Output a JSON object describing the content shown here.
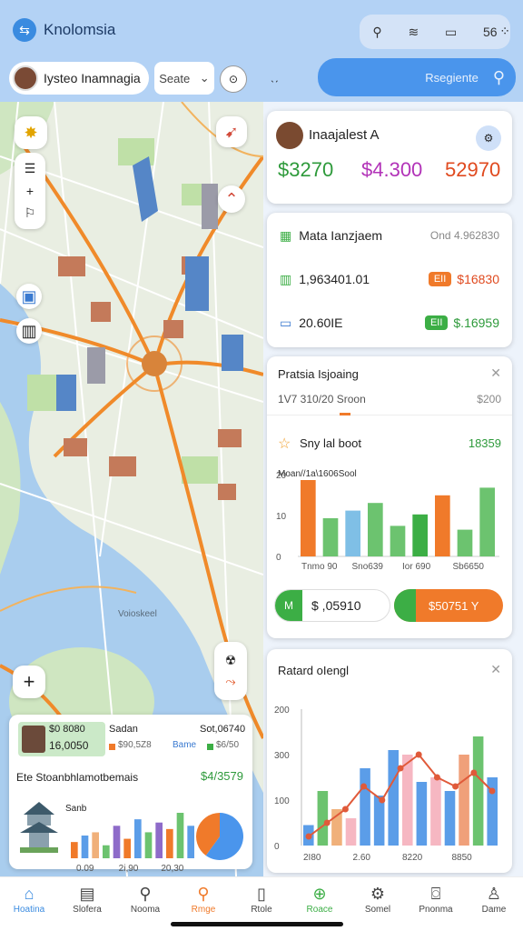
{
  "app": {
    "title": "Knolomsia"
  },
  "header": {
    "status_text": "56",
    "profile_name": "Iysteo Inamnagia",
    "select_value": "Seate",
    "search_label": "Rsegiente"
  },
  "map": {
    "area_label": "Voioskeel",
    "add_label": "+"
  },
  "card1": {
    "title": "Inaajalest A",
    "kpis": [
      {
        "value": "$3270",
        "color": "#2e9a3b"
      },
      {
        "value": "$4.300",
        "color": "#b233b8"
      },
      {
        "value": "52970",
        "color": "#e04a1f"
      }
    ]
  },
  "card2": {
    "rows": [
      {
        "icon": "building-icon",
        "label": "Mata Ianzjaem",
        "right": "Ond 4.962830",
        "badge": "",
        "badge_color": ""
      },
      {
        "icon": "chart-icon",
        "label": "1,963401.01",
        "right": "$16830",
        "badge": "EII",
        "badge_color": "#f07a2a"
      },
      {
        "icon": "card-icon",
        "label": "20.60IE",
        "right": "$.16959",
        "badge": "EII",
        "badge_color": "#3cae45"
      }
    ]
  },
  "card3": {
    "title": "Pratsia Isjoaing",
    "sub_left": "1V7  310/20  Sroon",
    "sub_right": "$200",
    "star_label": "Sny lal boot",
    "star_value": "18359",
    "chart_title": "Moan//1a\\1606Sool",
    "btn_left": "$ ,05910",
    "btn_right": "$50751 Y"
  },
  "card4": {
    "title": "Ratard oIengl"
  },
  "mini": {
    "tag": "$0 8080",
    "tag2": "16,0050",
    "label1": "Sadan",
    "label2": "Sot,06740",
    "legend1": "$90,5Z8",
    "legend2": "Bame",
    "legend3": "$6/50",
    "title": "Ete Stoanbhlamotbemais",
    "title_value": "$4/3579",
    "chart_caption": "Sanb"
  },
  "chart_data": [
    {
      "type": "bar",
      "title": "Moan//1a\\1606Sool",
      "categories": [
        "Tnmo 90",
        "Sno639",
        "Ior 690",
        "Sb6650"
      ],
      "series": [
        {
          "values": [
            20,
            10,
            12,
            14,
            8,
            11,
            16,
            7,
            18
          ],
          "colors": [
            "#f07a2a",
            "#6cc36f",
            "#7fbfe6",
            "#6cc36f",
            "#6cc36f",
            "#3cae45",
            "#f07a2a",
            "#6cc36f",
            "#6cc36f"
          ]
        }
      ],
      "yticks": [
        "20",
        "10",
        "0"
      ],
      "ylim": [
        0,
        30
      ]
    },
    {
      "type": "bar",
      "title": "Ratard oIengl",
      "categories": [
        "2I80",
        "2.60",
        "8220",
        "8850"
      ],
      "yticks": [
        "200",
        "300",
        "100",
        "0"
      ],
      "ylim": [
        0,
        300
      ],
      "bars": [
        {
          "value": 45,
          "color": "#5b9de8"
        },
        {
          "value": 120,
          "color": "#6cc36f"
        },
        {
          "value": 80,
          "color": "#f0b07a"
        },
        {
          "value": 60,
          "color": "#f6b7c2"
        },
        {
          "value": 170,
          "color": "#5b9de8"
        },
        {
          "value": 110,
          "color": "#5b9de8"
        },
        {
          "value": 210,
          "color": "#5b9de8"
        },
        {
          "value": 200,
          "color": "#f6b7c2"
        },
        {
          "value": 140,
          "color": "#5b9de8"
        },
        {
          "value": 150,
          "color": "#f6b7c2"
        },
        {
          "value": 120,
          "color": "#5b9de8"
        },
        {
          "value": 200,
          "color": "#f0a07a"
        },
        {
          "value": 240,
          "color": "#6cc36f"
        },
        {
          "value": 150,
          "color": "#5b9de8"
        }
      ],
      "line": [
        20,
        50,
        80,
        130,
        100,
        170,
        200,
        150,
        130,
        160,
        120
      ]
    },
    {
      "type": "bar",
      "title": "Sanb",
      "categories": [
        "0.09",
        "2i,90",
        "20,30"
      ],
      "values": [
        5,
        7,
        8,
        4,
        10,
        6,
        12,
        8,
        11,
        9,
        14,
        10
      ],
      "colors": [
        "#f07a2a",
        "#5b9de8",
        "#f0b07a",
        "#6cc36f",
        "#8e6bc9",
        "#f07a2a",
        "#5b9de8",
        "#6cc36f",
        "#8e6bc9",
        "#f07a2a",
        "#6cc36f",
        "#5b9de8"
      ]
    },
    {
      "type": "pie",
      "slices": [
        {
          "value": 60,
          "color": "#4a95ec"
        },
        {
          "value": 40,
          "color": "#f07a2a"
        }
      ]
    }
  ],
  "nav": {
    "items": [
      {
        "label": "Hoatina",
        "icon": "home-icon",
        "glyph": "⌂"
      },
      {
        "label": "Slofera",
        "icon": "calculator-icon",
        "glyph": "▤"
      },
      {
        "label": "Nooma",
        "icon": "search-badge-icon",
        "glyph": "⚲"
      },
      {
        "label": "Rmge",
        "icon": "search-icon",
        "glyph": "⚲"
      },
      {
        "label": "Rtole",
        "icon": "clipboard-icon",
        "glyph": "▯"
      },
      {
        "label": "Roace",
        "icon": "plus-circle-icon",
        "glyph": "⊕"
      },
      {
        "label": "Somel",
        "icon": "settings-icon",
        "glyph": "⚙"
      },
      {
        "label": "Pnonma",
        "icon": "chat-icon",
        "glyph": "⌼"
      },
      {
        "label": "Dame",
        "icon": "user-icon",
        "glyph": "♙"
      }
    ]
  }
}
